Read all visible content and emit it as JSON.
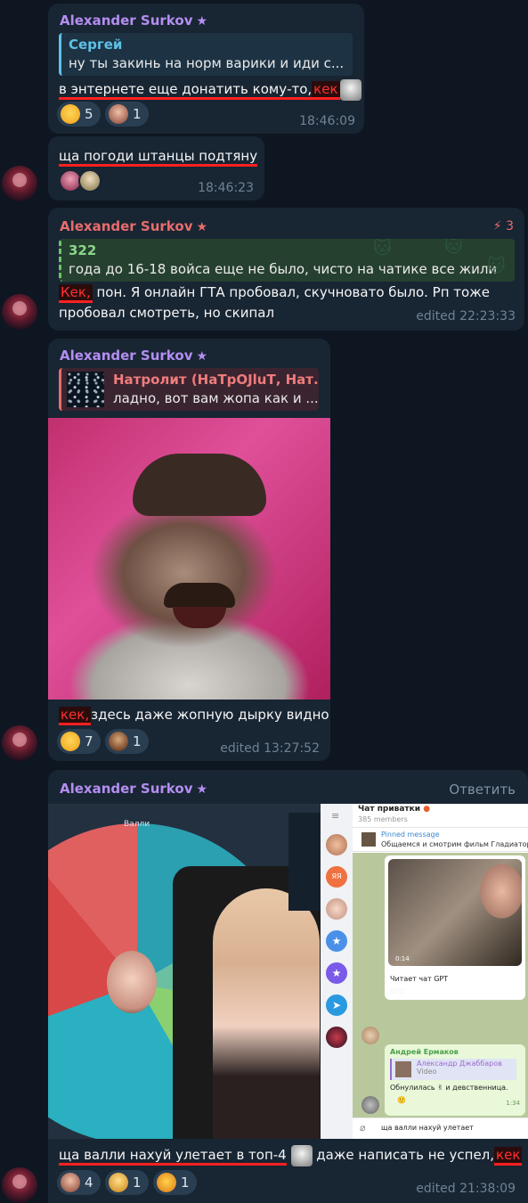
{
  "messages": [
    {
      "sender": "Alexander Surkov",
      "reply_name": "Сергей",
      "reply_text": "ну ты закинь на норм варики и иди с...",
      "text_before": "в энтернете еще донатить кому-то,",
      "kek": "кек",
      "reactions": [
        {
          "icon": "grin-emoji",
          "count": "5"
        },
        {
          "icon": "face-sticker",
          "count": "1"
        }
      ],
      "time": "18:46:09"
    },
    {
      "text": "ща погоди штанцы подтяну",
      "time": "18:46:23"
    },
    {
      "sender": "Alexander Surkov",
      "boost": "3",
      "reply_name": "322",
      "reply_text": "года до 16-18 войса еще не было, чисто на чатике все жили",
      "kek": "Кек,",
      "text_line1": " пон. Я онлайн ГТА пробовал, скучновато было. Рп тоже",
      "text_line2": "пробовал смотреть, но скипал",
      "time": "edited 22:23:33"
    },
    {
      "sender": "Alexander Surkov",
      "reply_name": "Натролит (НаТрОЈluТ, Нат...",
      "reply_text": "ладно, вот вам жопа как и ...",
      "kek": "кек,",
      "text_after": "здесь даже жопную дырку видно",
      "reactions": [
        {
          "icon": "grin-emoji",
          "count": "7"
        },
        {
          "icon": "mustache-sticker",
          "count": "1"
        }
      ],
      "time": "edited 13:27:52"
    },
    {
      "sender": "Alexander Surkov",
      "reply_button": "Ответить",
      "text_before": "ща валли нахуй улетает в топ-4",
      "text_middle": "даже написать не успел,",
      "kek": "кек",
      "reactions": [
        {
          "icon": "face-sticker",
          "count": "4"
        },
        {
          "icon": "raised-hands-emoji",
          "count": "1"
        },
        {
          "icon": "wow-emoji",
          "count": "1"
        }
      ],
      "time": "edited 21:38:09"
    }
  ],
  "stream_screenshot": {
    "wheel_label": "Валли",
    "chat_title": "Чат приватки",
    "members": "385 members",
    "pinned_label": "Pinned message",
    "pinned_text": "Общаемся и смотрим фильм Гладиатор (",
    "video_time": "0:14",
    "caption1": "Читает чат GPT",
    "reply_author": "Андрей Ермаков",
    "nested_reply_name": "Александр Джаббаров",
    "nested_reply_type": "Video",
    "reply_text": "Обнулилась ✌ и девственница.",
    "reply_time": "1:34",
    "input_text": "ща валли нахуй улетает",
    "sidebar_badge": "ЯЯ"
  },
  "colors": {
    "background": "#0e1621",
    "bubble": "#182533",
    "sender_purple": "#b48ef2",
    "sender_red": "#e86c6c",
    "kek_red": "#ff3030",
    "time_gray": "#6f8394"
  }
}
